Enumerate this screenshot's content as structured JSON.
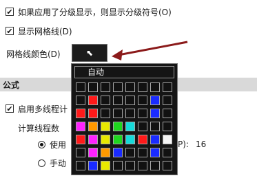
{
  "options": {
    "outline_symbols": {
      "label": "如果应用了分级显示，则显示分级符号(O)",
      "checked": true
    },
    "show_gridlines": {
      "label": "显示网格线(D)",
      "checked": true
    },
    "gridline_color": {
      "label": "网格线颜色(D)",
      "button_glyph": "⬉"
    }
  },
  "palette": {
    "auto_label": "自动",
    "swatches": [
      "#111111",
      "#111111",
      "#111111",
      "#111111",
      "#111111",
      "#111111",
      "#111111",
      "#111111",
      "#111111",
      "#ff1a1a",
      "#111111",
      "#111111",
      "#111111",
      "#111111",
      "#1a2bff",
      "#111111",
      "#ff1a1a",
      "#ff1a1a",
      "#111111",
      "#111111",
      "#111111",
      "#111111",
      "#1a2bff",
      "#111111",
      "#ff22ff",
      "#ff9900",
      "#e8e800",
      "#1fd61f",
      "#16d9d9",
      "#111111",
      "#111111",
      "#111111",
      "#ff1a1a",
      "#ff22ff",
      "#e8e800",
      "#1fd61f",
      "#16d9d9",
      "#ff1a1a",
      "#1a2bff",
      "#f5f5f5",
      "#111111",
      "#ff22ff",
      "#ff9900",
      "#1a2bff",
      "#111111",
      "#111111",
      "#1a2bff",
      "#111111",
      "#111111",
      "#1a2bff",
      "#e8e800",
      "#111111",
      "#111111",
      "#111111",
      "#111111",
      "#111111"
    ]
  },
  "formulas": {
    "section_title": "公式",
    "multithread": {
      "label": "启用多线程计",
      "checked": true
    },
    "threads_label": "计算线程数",
    "use_all": {
      "label": "使用",
      "tail": "P):",
      "value": "16",
      "selected": true
    },
    "manual": {
      "label": "手动",
      "selected": false
    }
  },
  "colors": {
    "arrow": "#8b1a1a",
    "section_bg": "#d9d9d9",
    "palette_bg": "#151515"
  }
}
